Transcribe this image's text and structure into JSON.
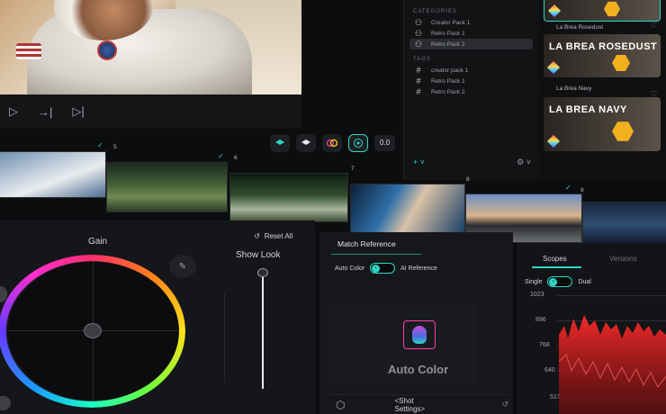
{
  "library": {
    "categories_heading": "CATEGORIES",
    "categories": [
      {
        "label": "Creator Pack 1",
        "icon": "group-icon"
      },
      {
        "label": "Retro Pack 1",
        "icon": "group-icon"
      },
      {
        "label": "Retro Pack 2",
        "icon": "group-icon",
        "selected": true
      }
    ],
    "tags_heading": "TAGS",
    "tags": [
      {
        "label": "creator pack 1",
        "icon": "hash-icon"
      },
      {
        "label": "Retro Pack 1",
        "icon": "hash-icon"
      },
      {
        "label": "Retro Pack 2",
        "icon": "hash-icon"
      }
    ]
  },
  "presets": [
    {
      "card_title": "",
      "label": "La Brea Rosedust"
    },
    {
      "card_title": "LA BREA ROSEDUST",
      "label": "La Brea Navy"
    },
    {
      "card_title": "LA BREA NAVY",
      "label": ""
    }
  ],
  "toolbar": {
    "value": "0.0"
  },
  "filmstrip": {
    "clips": [
      {
        "number": "5",
        "checked": true
      },
      {
        "number": "6",
        "checked": true
      },
      {
        "number": "7",
        "checked": false
      },
      {
        "number": "8",
        "checked": false
      },
      {
        "number": "9",
        "checked": true
      }
    ]
  },
  "color": {
    "gain_label": "Gain",
    "reset_all": "Reset All",
    "show_look": "Show Look",
    "wheel_colors": [
      "#ff2e6e",
      "#ffe21a",
      "#6dff3a",
      "#1a9bff",
      "#ff2ecf"
    ]
  },
  "match": {
    "title": "Match Reference",
    "auto_color": "Auto Color",
    "ai_reference": "AI Reference",
    "auto_color_big": "Auto Color",
    "shot_settings": "<Shot Settings>"
  },
  "scopes": {
    "tab_scopes": "Scopes",
    "tab_versions": "Versions",
    "single": "Single",
    "dual": "Dual",
    "y_labels": [
      "1023",
      "896",
      "768",
      "640",
      "512"
    ],
    "accent": "#ff2b2b"
  },
  "theme": {
    "accent": "#2fd6c4"
  }
}
